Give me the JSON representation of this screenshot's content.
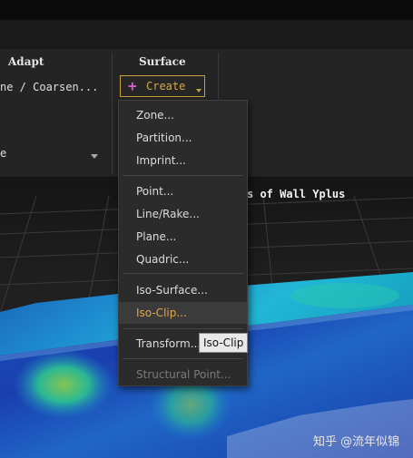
{
  "ribbon": {
    "adapt": {
      "title": "Adapt",
      "refine_label": "ne / Coarsen...",
      "partial_text": "e"
    },
    "surface": {
      "title": "Surface",
      "create_button": {
        "icon": "plus-icon",
        "label": "Create"
      }
    }
  },
  "viewport": {
    "title_fragment": "s of Wall Yplus"
  },
  "menu": {
    "items": [
      {
        "label": "Zone...",
        "state": "normal"
      },
      {
        "label": "Partition...",
        "state": "normal"
      },
      {
        "label": "Imprint...",
        "state": "normal"
      },
      {
        "label": "Point...",
        "state": "normal"
      },
      {
        "label": "Line/Rake...",
        "state": "normal"
      },
      {
        "label": "Plane...",
        "state": "normal"
      },
      {
        "label": "Quadric...",
        "state": "normal"
      },
      {
        "label": "Iso-Surface...",
        "state": "normal"
      },
      {
        "label": "Iso-Clip...",
        "state": "hovered"
      },
      {
        "label": "Transform...",
        "state": "normal"
      },
      {
        "label": "Structural Point...",
        "state": "disabled"
      }
    ]
  },
  "tooltip": {
    "text": "Iso-Clip"
  },
  "watermark": {
    "text": "知乎 @流年似锦"
  },
  "colors": {
    "accent": "#e5a54d",
    "button_border": "#c9a040",
    "plus": "#d85cc7",
    "menu_bg": "#2b2b2b"
  }
}
